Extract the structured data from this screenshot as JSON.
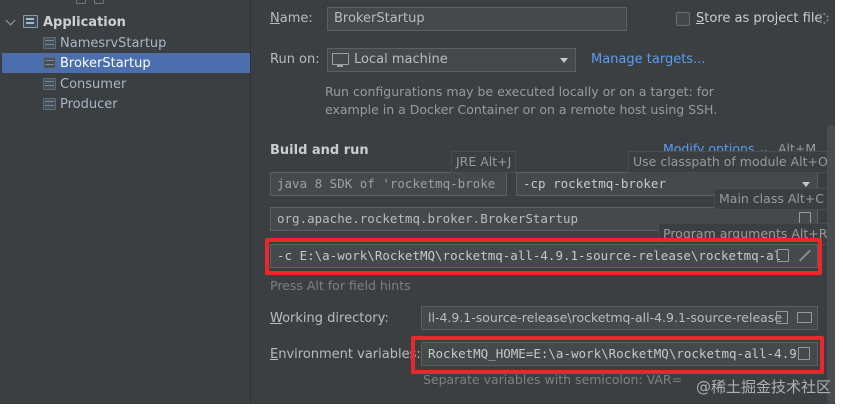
{
  "tree": {
    "group_label": "Application",
    "items": [
      {
        "label": "NamesrvStartup",
        "selected": false
      },
      {
        "label": "BrokerStartup",
        "selected": true
      },
      {
        "label": "Consumer",
        "selected": false
      },
      {
        "label": "Producer",
        "selected": false
      }
    ]
  },
  "form": {
    "name_label_u": "N",
    "name_label_rest": "ame:",
    "name_value": "BrokerStartup",
    "store_label_u": "S",
    "store_label_rest": "tore as project file",
    "run_on_label": "Run on:",
    "run_on_value": "Local machine",
    "manage_targets": "Manage targets...",
    "run_on_hint_line1": "Run configurations may be executed locally or on a target: for",
    "run_on_hint_line2": "example in a Docker Container or on a remote host using SSH.",
    "build_and_run": "Build and run",
    "modify_options": "Modify options",
    "modify_shortcut": "Alt+M",
    "jre_hint": "JRE Alt+J",
    "classpath_hint": "Use classpath of module Alt+O",
    "jre_select": "java 8  SDK of 'rocketmq-broke",
    "module_select": "-cp  rocketmq-broker",
    "main_class_hint": "Main class Alt+C",
    "main_class_value": "org.apache.rocketmq.broker.BrokerStartup",
    "program_args_hint": "Program arguments Alt+R",
    "program_args_value": "-c E:\\a-work\\RocketMQ\\rocketmq-all-4.9.1-source-release\\rocketmq-al",
    "field_hints": "Press Alt for field hints",
    "working_dir_label_u": "W",
    "working_dir_label_rest": "orking directory:",
    "working_dir_value": "ll-4.9.1-source-release\\rocketmq-all-4.9.1-source-release",
    "env_label_u": "E",
    "env_label_rest": "nvironment variables:",
    "env_value": "RocketMQ_HOME=E:\\a-work\\RocketMQ\\rocketmq-all-4.9",
    "env_hint": "Separate variables with semicolon: VAR=",
    "watermark": "@稀土掘金技术社区"
  },
  "colors": {
    "panel_bg": "#3c3f41",
    "selection": "#4b6eaf",
    "link": "#589df6",
    "highlight_box": "#e8282b"
  }
}
